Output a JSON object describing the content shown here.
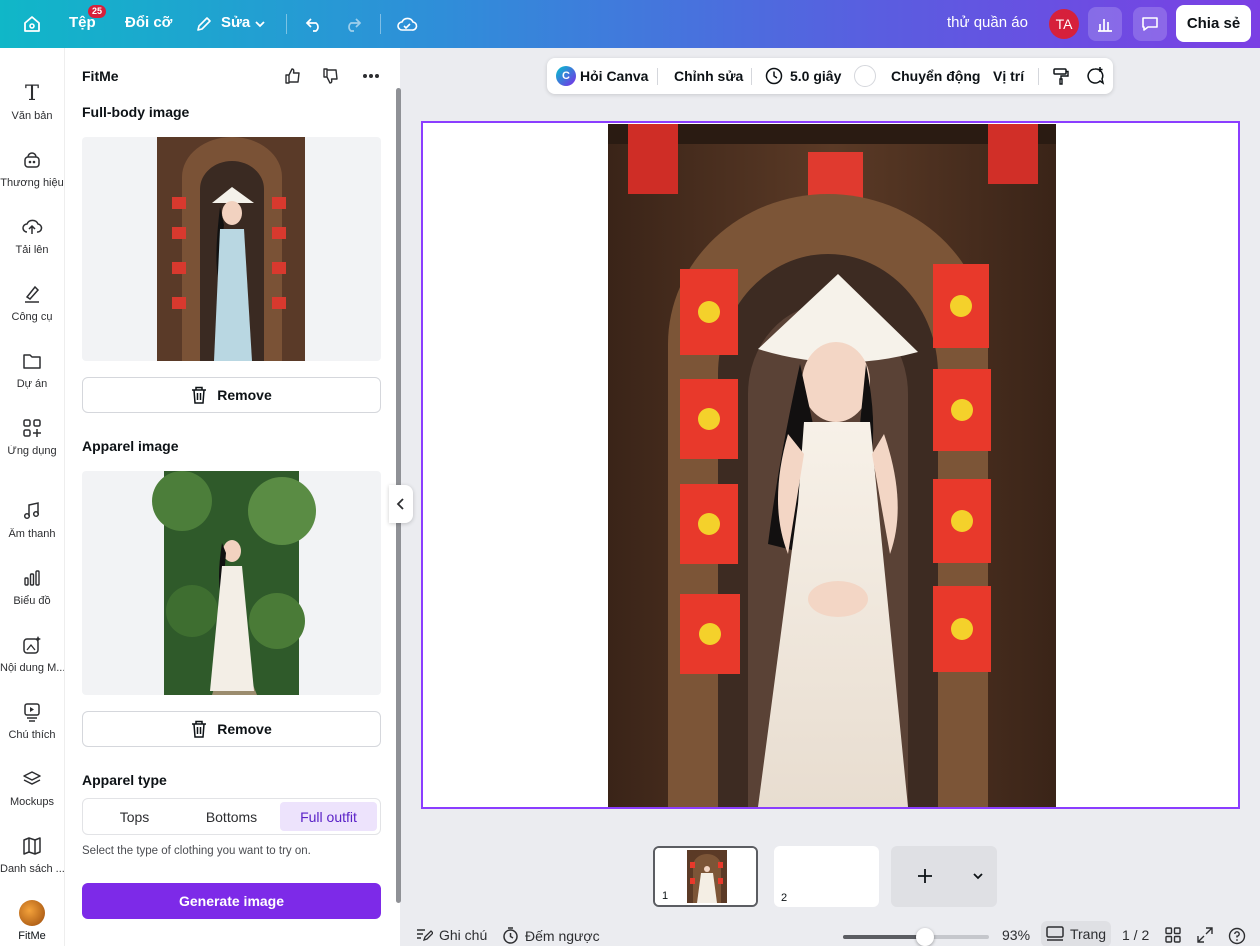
{
  "topbar": {
    "file_label": "Tệp",
    "file_badge": "25",
    "resize_label": "Đổi cỡ",
    "edit_label": "Sửa",
    "doc_title": "thử quần áo",
    "avatar_initials": "TA",
    "share_label": "Chia sẻ"
  },
  "rail": {
    "items": [
      {
        "label": "Văn bản",
        "icon": "text-icon"
      },
      {
        "label": "Thương hiệu",
        "icon": "brand-icon"
      },
      {
        "label": "Tải lên",
        "icon": "upload-cloud-icon"
      },
      {
        "label": "Công cụ",
        "icon": "draw-tool-icon"
      },
      {
        "label": "Dự án",
        "icon": "folder-icon"
      },
      {
        "label": "Ứng dụng",
        "icon": "apps-grid-icon"
      },
      {
        "label": "Âm thanh",
        "icon": "music-note-icon"
      },
      {
        "label": "Biểu đồ",
        "icon": "bar-chart-icon"
      },
      {
        "label": "Nội dung M...",
        "icon": "magic-media-icon"
      },
      {
        "label": "Chú thích",
        "icon": "caption-icon"
      },
      {
        "label": "Mockups",
        "icon": "layers-icon"
      },
      {
        "label": "Danh sách ...",
        "icon": "map-icon"
      },
      {
        "label": "FitMe",
        "icon": "fitme-app-icon"
      }
    ]
  },
  "panel": {
    "title": "FitMe",
    "fullbody_heading": "Full-body image",
    "apparel_heading": "Apparel image",
    "remove_label": "Remove",
    "apparel_type_heading": "Apparel type",
    "apparel_options": [
      "Tops",
      "Bottoms",
      "Full outfit"
    ],
    "apparel_selected": "Full outfit",
    "hint": "Select the type of clothing you want to try on.",
    "generate_label": "Generate image"
  },
  "floating_toolbar": {
    "ask_canva": "Hỏi Canva",
    "edit": "Chỉnh sửa",
    "duration": "5.0 giây",
    "animate": "Chuyển động",
    "position": "Vị trí"
  },
  "pages": {
    "thumb1": "1",
    "thumb2": "2"
  },
  "bottombar": {
    "notes": "Ghi chú",
    "timer": "Đếm ngược",
    "zoom": "93%",
    "zoom_fraction": 0.56,
    "pages_label": "Trang",
    "page_count": "1 / 2"
  },
  "colors": {
    "accent": "#7d2ae8",
    "selection": "#8b3dff",
    "badge": "#d6203b"
  }
}
